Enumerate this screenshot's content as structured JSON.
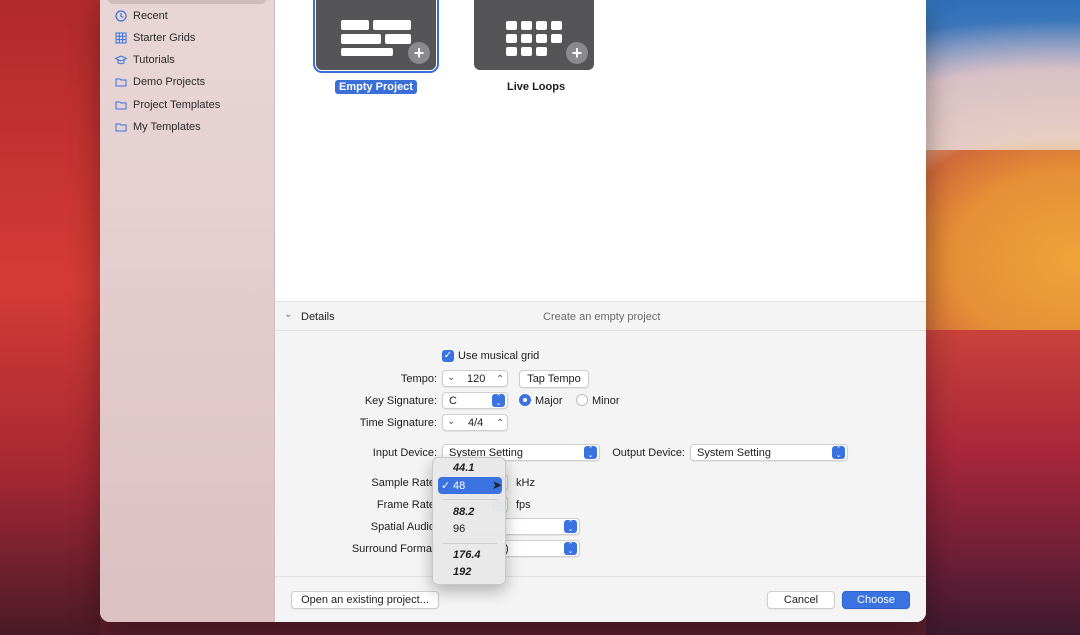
{
  "sidebar": {
    "items": [
      {
        "label": "Recent",
        "icon": "clock-icon"
      },
      {
        "label": "Starter Grids",
        "icon": "grid-icon"
      },
      {
        "label": "Tutorials",
        "icon": "mortarboard-icon"
      },
      {
        "label": "Demo Projects",
        "icon": "folder-icon"
      },
      {
        "label": "Project Templates",
        "icon": "folder-icon"
      },
      {
        "label": "My Templates",
        "icon": "folder-icon"
      }
    ]
  },
  "templates": [
    {
      "label": "Empty Project",
      "selected": true
    },
    {
      "label": "Live Loops",
      "selected": false
    }
  ],
  "details": {
    "header": "Details",
    "description": "Create an empty project",
    "use_musical_grid": "Use musical grid",
    "tempo_label": "Tempo:",
    "tempo_value": "120",
    "tap_tempo": "Tap Tempo",
    "key_label": "Key Signature:",
    "key_value": "C",
    "major": "Major",
    "minor": "Minor",
    "time_label": "Time Signature:",
    "time_value": "4/4",
    "input_label": "Input Device:",
    "input_value": "System Setting",
    "output_label": "Output Device:",
    "output_value": "System Setting",
    "sample_rate_label": "Sample Rate",
    "sample_rate_unit": "kHz",
    "frame_rate_label": "Frame Rate",
    "frame_rate_unit": "fps",
    "spatial_label": "Spatial Audio",
    "surround_label": "Surround Format",
    "surround_partial": ")"
  },
  "sample_rate_menu": {
    "options": [
      "44.1",
      "48",
      "88.2",
      "96",
      "176.4",
      "192"
    ],
    "selected": "48"
  },
  "footer": {
    "open_existing": "Open an existing project...",
    "cancel": "Cancel",
    "choose": "Choose"
  },
  "colors": {
    "accent": "#3a72e0",
    "tile": "#555558"
  }
}
